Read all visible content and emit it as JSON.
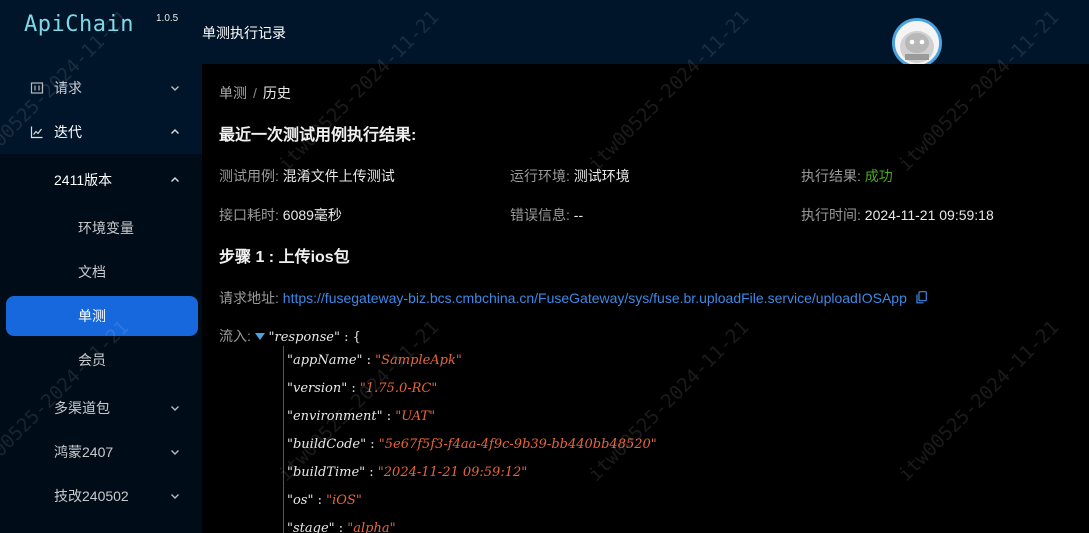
{
  "app": {
    "name": "ApiChain",
    "version": "1.0.5"
  },
  "header": {
    "title": "单测执行记录"
  },
  "sidebar": {
    "items": [
      {
        "label": "请求",
        "icon": "request-icon"
      },
      {
        "label": "迭代",
        "icon": "chart-line-icon"
      },
      {
        "label": "2411版本"
      },
      {
        "label": "环境变量"
      },
      {
        "label": "文档"
      },
      {
        "label": "单测"
      },
      {
        "label": "会员"
      },
      {
        "label": "多渠道包"
      },
      {
        "label": "鸿蒙2407"
      },
      {
        "label": "技改240502"
      }
    ]
  },
  "breadcrumb": {
    "parent": "单测",
    "current": "历史"
  },
  "result": {
    "title": "最近一次测试用例执行结果:",
    "case_label": "测试用例:",
    "case_value": "混淆文件上传测试",
    "env_label": "运行环境:",
    "env_value": "测试环境",
    "status_label": "执行结果:",
    "status_value": "成功",
    "duration_label": "接口耗时:",
    "duration_value": "6089毫秒",
    "error_label": "错误信息:",
    "error_value": "--",
    "time_label": "执行时间:",
    "time_value": "2024-11-21 09:59:18"
  },
  "step": {
    "title": "步骤 1 : 上传ios包",
    "url_label": "请求地址:",
    "url": "https://fusegateway-biz.bcs.cmbchina.cn/FuseGateway/sys/fuse.br.uploadFile.service/uploadIOSApp",
    "input_label": "流入:",
    "root_key": "\"response\"",
    "fields": [
      {
        "key": "\"appName\"",
        "value": "\"SampleApk\""
      },
      {
        "key": "\"version\"",
        "value": "\"1.75.0-RC\""
      },
      {
        "key": "\"environment\"",
        "value": "\"UAT\""
      },
      {
        "key": "\"buildCode\"",
        "value": "\"5e67f5f3-f4aa-4f9c-9b39-bb440bb48520\""
      },
      {
        "key": "\"buildTime\"",
        "value": "\"2024-11-21 09:59:12\""
      },
      {
        "key": "\"os\"",
        "value": "\"iOS\""
      },
      {
        "key": "\"stage\"",
        "value": "\"alpha\""
      }
    ]
  },
  "watermark": "itw00525-2024-11-21",
  "colors": {
    "accent": "#1668dc",
    "success": "#49aa19",
    "link": "#3c89e8",
    "json_string": "#e8643c",
    "sidebar_bg": "#001529"
  }
}
